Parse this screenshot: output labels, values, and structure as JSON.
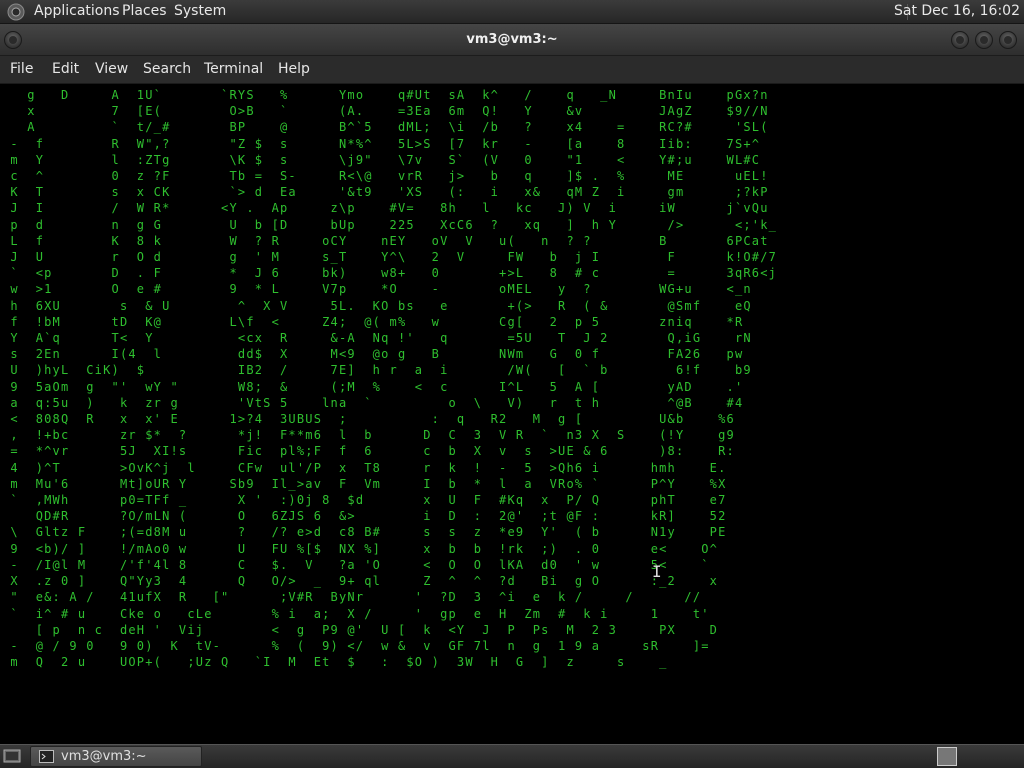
{
  "top_panel": {
    "menus": [
      "Applications",
      "Places",
      "System"
    ],
    "clock": "Sat Dec 16, 16:02"
  },
  "window": {
    "title": "vm3@vm3:~"
  },
  "menubar": {
    "items": [
      "File",
      "Edit",
      "View",
      "Search",
      "Terminal",
      "Help"
    ]
  },
  "terminal": {
    "matrix_lines": [
      "   g   D     A  1U`       `RYS   %      Ymo    q#Ut  sA  k^   /    q   _N     BnIu    pGx?n",
      "   x         7  [E(        O>B   `      (A.    =3Ea  6m  Q!   Y    &v         JAgZ    $9//N",
      "   A         `  t/_#       BP    @      B^`5   dML;  \\i  /b   ?    x4    =    RC?#     'SL(",
      " -  f        R  W\",?       \"Z $  s      N*%^   5L>S  [7  kr   -    [a    8    Iib:    7S+^",
      " m  Y        l  :ZTg       \\K $  s      \\j9\"   \\7v   S`  (V   0    \"1    <    Y#;u    WL#C",
      " c  ^        0  z ?F       Tb =  S-     R<\\@   vrR   j>   b   q    ]$ .  %     ME      uEL!",
      " K  T        s  x CK       `> d  Ea     '&t9   'XS   (:   i   x&   qM Z  i     gm      ;?kP",
      " J  I        /  W R*      <Y .  Ap     z\\p    #V=   8h   l   kc   J) V  i     iW      j`vQu",
      " p  d        n  g G        U  b [D     bUp    225   XcC6  ?   xq   ]  h Y      />      <;'k_",
      " L  f        K  8 k        W  ? R     oCY    nEY   oV  V   u(   n  ? ?        B       6PCat",
      " J  U        r  O d        g  ' M     s_T    Y^\\   2  V     FW   b  j I        F      k!O#/7",
      " `  <p       D  . F        *  J 6     bk)    w8+   0       +>L   8  # c        =      3qR6<j",
      " w  >1       O  e #        9  * L     V7p    *O    -       oMEL   y  ?        WG+u    <_n",
      " h  6XU       s  & U        ^  X V     5L.  KO bs   e       +(>   R  ( &       @Smf    eQ",
      " f  !bM      tD  K@        L\\f  <     Z4;  @( m%   w       Cg[   2  p 5       zniq    *R",
      " Y  A`q      T<  Y          <cx  R     &-A  Nq !'   q       =5U   T  J 2       Q,iG    rN",
      " s  2En      I(4  l         dd$  X     M<9  @o g   B       NWm   G  0 f        FA26   pw",
      " U  )hyL  CiK)  $           IB2  /     7E]  h r  a  i       /W(   [  ` b        6!f    b9",
      " 9  5aOm  g  \"'  wY \"       W8;  &     (;M  %    <  c      I^L   5  A [        yAD    .'",
      " a  q:5u  )   k  zr g       'VtS 5    lna  `         o  \\   V)   r  t h        ^@B    #4",
      " <  808Q  R   x  x' E      1>?4  3UBUS  ;          :  q   R2   M  g [         U&b    %6",
      " ,  !+bc      zr $*  ?      *j!  F**m6  l  b      D  C  3  V R  `  n3 X  S    (!Y    g9",
      " =  *^vr      5J  XI!s      Fic  pl%;F  f  6      c  b  X  v  s  >UE & 6      )8:    R:",
      " 4  )^T       >OvK^j  l     CFw  ul'/P  x  T8     r  k  !  -  5  >Qh6 i      hmh    E.",
      " m  Mu'6      Mt]oUR Y     Sb9  Il_>av  F  Vm     I  b  *  l  a  VRo% `      P^Y    %X",
      " `  ,MWh      p0=TFf _      X '  :)0j 8  $d       x  U  F  #Kq  x  P/ Q      phT    e7",
      "    QD#R      ?O/mLN (      O   6ZJS 6  &>        i  D  :  2@'  ;t @F :      kR]    52",
      " \\  Gltz F    ;(=d8M u      ?   /? e>d  c8 B#     s  s  z  *e9  Y'  ( b      N1y    PE",
      " 9  <b)/ ]    !/mAo0 w      U   FU %[$  NX %]     x  b  b  !rk  ;)  . 0      e<    O^",
      " -  /I@l M    /'f'4l 8      C   $.  V   ?a 'O     <  O  O  lKA  d0  ' w      5<    `",
      " X  .z 0 ]    Q\"Yy3  4      Q   O/>  _  9+ ql     Z  ^  ^  ?d   Bi  g O      :_2    x",
      " \"  e&: A /   41ufX  R   [\"      ;V#R  ByNr      '  ?D  3  ^i  e  k /     /      //",
      " `  i^ # u    Cke o   cLe       % i  a;  X /     '  gp  e  H  Zm  #  k i     1    t'",
      "    [ p  n c  deH '  Vij        <  g  P9 @'  U [  k  <Y  J  P  Ps  M  2 3     PX    D",
      " -  @ / 9 0   9 0)  K  tV-      %  (  9) </  w &  v  GF 7l  n  g  1 9 a     sR    ]=",
      " m  Q  2 u    UOP+(   ;Uz Q   `I  M  Et  $   :  $O )  3W  H  G  ]  z     s    _"
    ],
    "cursor_glyph": "I"
  },
  "bottom_panel": {
    "task_label": "vm3@vm3:~"
  },
  "colors": {
    "matrix_green": "#2fbf2f",
    "matrix_white": "#ffffff",
    "panel_bg": "#2f2f2f",
    "terminal_bg": "#000000"
  }
}
